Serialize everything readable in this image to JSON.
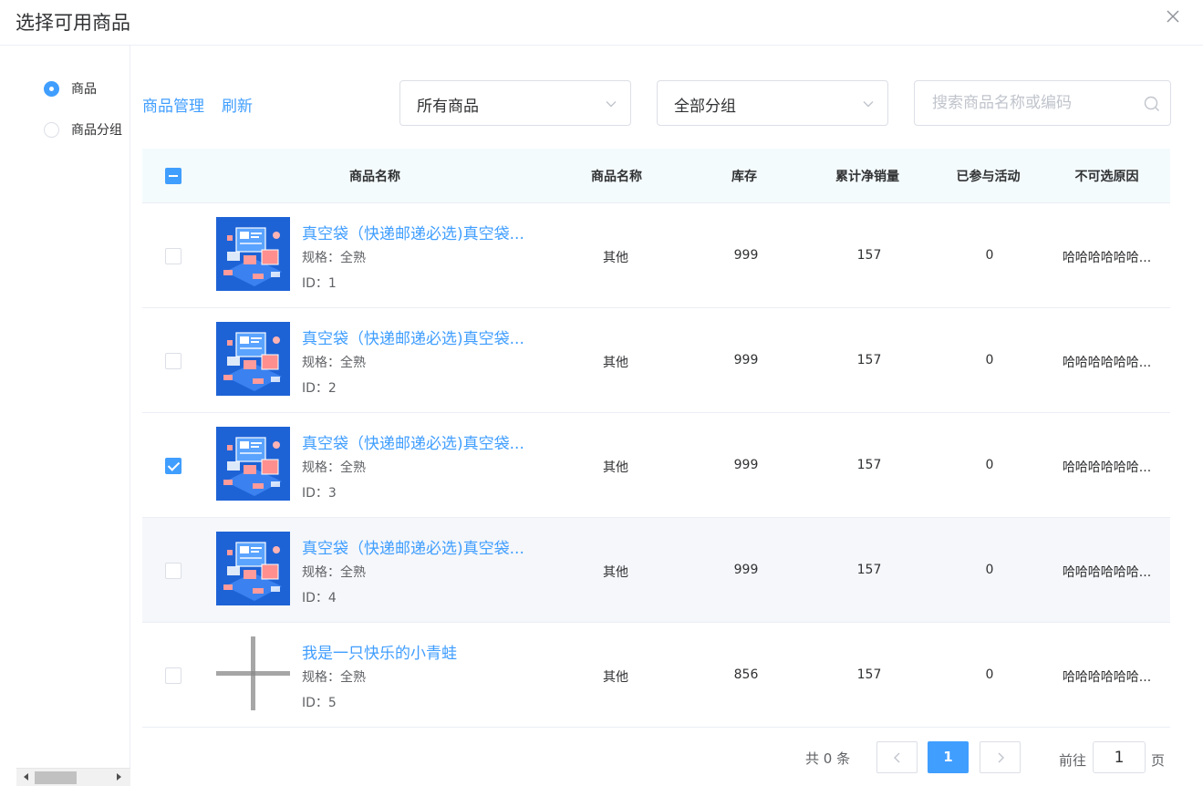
{
  "dialog": {
    "title": "选择可用商品"
  },
  "left_panel": {
    "options": [
      {
        "label": "商品",
        "checked": true
      },
      {
        "label": "商品分组",
        "checked": false
      }
    ]
  },
  "toolbar": {
    "manage_link": "商品管理",
    "refresh_link": "刷新",
    "type_select": "所有商品",
    "group_select": "全部分组",
    "search_placeholder": "搜索商品名称或编码"
  },
  "table": {
    "headers": [
      "商品名称",
      "商品名称",
      "库存",
      "累计净销量",
      "已参与活动",
      "不可选原因"
    ],
    "header_checkbox": "indeterminate",
    "rows": [
      {
        "checked": false,
        "image": "product-illustration",
        "name": "真空袋（快递邮递必选)真空袋...",
        "spec": "规格：全熟",
        "id": "ID：1",
        "type": "其他",
        "stock": "999",
        "sales": "157",
        "activities": "0",
        "reason": "哈哈哈哈哈哈..."
      },
      {
        "checked": false,
        "image": "product-illustration",
        "name": "真空袋（快递邮递必选)真空袋...",
        "spec": "规格：全熟",
        "id": "ID：2",
        "type": "其他",
        "stock": "999",
        "sales": "157",
        "activities": "0",
        "reason": "哈哈哈哈哈哈..."
      },
      {
        "checked": true,
        "image": "product-illustration",
        "name": "真空袋（快递邮递必选)真空袋...",
        "spec": "规格：全熟",
        "id": "ID：3",
        "type": "其他",
        "stock": "999",
        "sales": "157",
        "activities": "0",
        "reason": "哈哈哈哈哈哈..."
      },
      {
        "checked": false,
        "image": "product-illustration",
        "name": "真空袋（快递邮递必选)真空袋...",
        "spec": "规格：全熟",
        "id": "ID：4",
        "type": "其他",
        "stock": "999",
        "sales": "157",
        "activities": "0",
        "reason": "哈哈哈哈哈哈..."
      },
      {
        "checked": false,
        "image": "placeholder-plus-icon",
        "name": "我是一只快乐的小青蛙",
        "spec": "规格：全熟",
        "id": "ID：5",
        "type": "其他",
        "stock": "856",
        "sales": "157",
        "activities": "0",
        "reason": "哈哈哈哈哈哈..."
      }
    ]
  },
  "pagination": {
    "total": "共 0 条",
    "current_page": "1",
    "goto_prefix": "前往",
    "goto_value": "1",
    "goto_suffix": "页"
  },
  "colors": {
    "accent": "#409eff",
    "header_bg": "#f4fbfc",
    "hover_bg": "#f5f7fa"
  }
}
